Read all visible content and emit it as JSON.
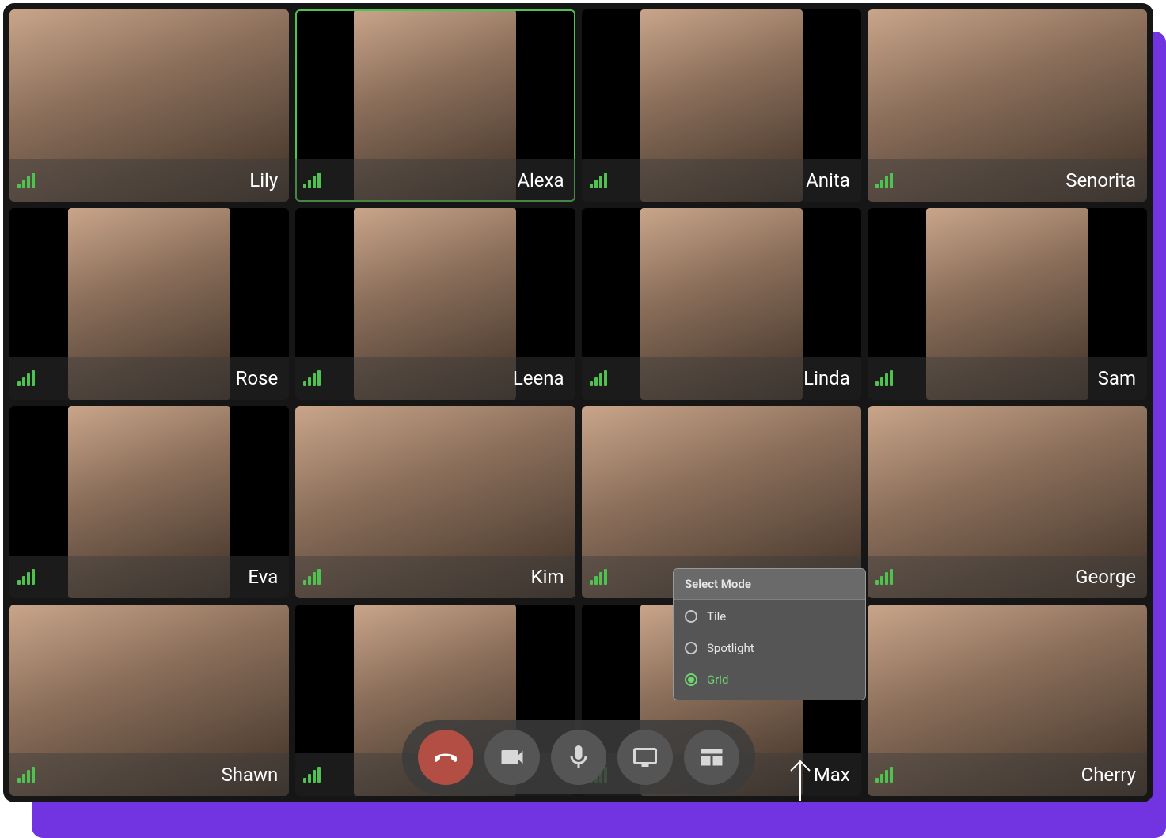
{
  "participants": [
    {
      "name": "Lily",
      "active": false,
      "avatar_wide": true
    },
    {
      "name": "Alexa",
      "active": true,
      "avatar_wide": false
    },
    {
      "name": "Anita",
      "active": false,
      "avatar_wide": false
    },
    {
      "name": "Senorita",
      "active": false,
      "avatar_wide": true
    },
    {
      "name": "Rose",
      "active": false,
      "avatar_wide": false
    },
    {
      "name": "Leena",
      "active": false,
      "avatar_wide": false
    },
    {
      "name": "Linda",
      "active": false,
      "avatar_wide": false
    },
    {
      "name": "Sam",
      "active": false,
      "avatar_wide": false
    },
    {
      "name": "Eva",
      "active": false,
      "avatar_wide": false
    },
    {
      "name": "Kim",
      "active": false,
      "avatar_wide": true
    },
    {
      "name": "",
      "active": false,
      "avatar_wide": true
    },
    {
      "name": "George",
      "active": false,
      "avatar_wide": true
    },
    {
      "name": "Shawn",
      "active": false,
      "avatar_wide": true
    },
    {
      "name": "",
      "active": false,
      "avatar_wide": false
    },
    {
      "name": "Max",
      "active": false,
      "avatar_wide": false
    },
    {
      "name": "Cherry",
      "active": false,
      "avatar_wide": true
    }
  ],
  "controls": {
    "hangup_icon": "hangup-icon",
    "camera_icon": "camera-icon",
    "mic_icon": "mic-icon",
    "screenshare_icon": "screenshare-icon",
    "layout_icon": "layout-icon"
  },
  "popover": {
    "title": "Select Mode",
    "options": [
      {
        "label": "Tile",
        "selected": false
      },
      {
        "label": "Spotlight",
        "selected": false
      },
      {
        "label": "Grid",
        "selected": true
      }
    ]
  },
  "colors": {
    "accent_purple": "#7233e0",
    "signal_green": "#4fc24f",
    "hangup_red": "#b34e44"
  }
}
